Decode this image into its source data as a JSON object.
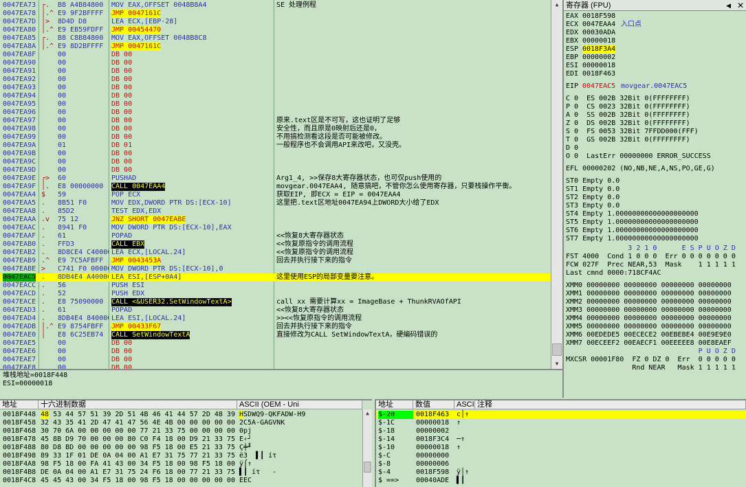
{
  "cpu": {
    "rows": [
      {
        "addr": "0047EA73",
        "mk": "┌.",
        "hex": "B8 A4B84800",
        "asm": "MOV EAX,OFFSET 0048B8A4",
        "cmt": "SE 处理例程"
      },
      {
        "addr": "0047EA78",
        "mk": "│.^",
        "hex": "E9 9F2BFFFF",
        "asm": "JMP 0047161C",
        "cmt": ""
      },
      {
        "addr": "0047EA7D",
        "mk": "│>",
        "hex": "8D4D D8",
        "asm": "LEA ECX,[EBP-28]",
        "cmt": ""
      },
      {
        "addr": "0047EA80",
        "mk": "│.^",
        "hex": "E9 EB59FDFF",
        "asm": "JMP 00454470",
        "cmt": ""
      },
      {
        "addr": "0047EA85",
        "mk": "┌.",
        "hex": "B8 C8B84800",
        "asm": "MOV EAX,OFFSET 0048B8C8",
        "cmt": ""
      },
      {
        "addr": "0047EA8A",
        "mk": "│.^",
        "hex": "E9 8D2BFFFF",
        "asm": "JMP 0047161C",
        "cmt": ""
      },
      {
        "addr": "0047EA8F",
        "mk": "",
        "hex": "00",
        "asm": "DB 00",
        "cmt": ""
      },
      {
        "addr": "0047EA90",
        "mk": "",
        "hex": "00",
        "asm": "DB 00",
        "cmt": ""
      },
      {
        "addr": "0047EA91",
        "mk": "",
        "hex": "00",
        "asm": "DB 00",
        "cmt": ""
      },
      {
        "addr": "0047EA92",
        "mk": "",
        "hex": "00",
        "asm": "DB 00",
        "cmt": ""
      },
      {
        "addr": "0047EA93",
        "mk": "",
        "hex": "00",
        "asm": "DB 00",
        "cmt": ""
      },
      {
        "addr": "0047EA94",
        "mk": "",
        "hex": "00",
        "asm": "DB 00",
        "cmt": ""
      },
      {
        "addr": "0047EA95",
        "mk": "",
        "hex": "00",
        "asm": "DB 00",
        "cmt": ""
      },
      {
        "addr": "0047EA96",
        "mk": "",
        "hex": "00",
        "asm": "DB 00",
        "cmt": ""
      },
      {
        "addr": "0047EA97",
        "mk": "",
        "hex": "00",
        "asm": "DB 00",
        "cmt": "原来.text区是不可写，这也证明了足够"
      },
      {
        "addr": "0047EA98",
        "mk": "",
        "hex": "00",
        "asm": "DB 00",
        "cmt": "安全性，而且原是0映射后还是0，"
      },
      {
        "addr": "0047EA99",
        "mk": "",
        "hex": "00",
        "asm": "DB 00",
        "cmt": "不用搞检测看这段是否可能被修改。"
      },
      {
        "addr": "0047EA9A",
        "mk": "",
        "hex": "01",
        "asm": "DB 01",
        "cmt": "一般程序也不会调用API来改吧，又没壳。"
      },
      {
        "addr": "0047EA9B",
        "mk": "",
        "hex": "00",
        "asm": "DB 00",
        "cmt": ""
      },
      {
        "addr": "0047EA9C",
        "mk": "",
        "hex": "00",
        "asm": "DB 00",
        "cmt": ""
      },
      {
        "addr": "0047EA9D",
        "mk": "",
        "hex": "00",
        "asm": "DB 00",
        "cmt": ""
      },
      {
        "addr": "0047EA9E",
        "mk": "┌>",
        "hex": "60",
        "asm": "PUSHAD",
        "cmt": "Arg1_4, >>保存8大寄存器状态，也可仅push使用的"
      },
      {
        "addr": "0047EA9F",
        "mk": "│.",
        "hex": "E8 00000000",
        "asm": "CALL 0047EAA4",
        "cmt": "movgear.0047EAA4, 随意搞吧，不管你怎么使用寄存器，只要栈操作平衡。"
      },
      {
        "addr": "0047EAA4",
        "mk": "$",
        "hex": "59",
        "asm": "POP ECX",
        "cmt": "获取EIP, 即ECX = EIP = 0047EAA4"
      },
      {
        "addr": "0047EAA5",
        "mk": ".",
        "hex": "8B51 F0",
        "asm": "MOV EDX,DWORD PTR DS:[ECX-10]",
        "cmt": "这里把.text区地址0047EA94上DWORD大小给了EDX"
      },
      {
        "addr": "0047EAA8",
        "mk": ".",
        "hex": "85D2",
        "asm": "TEST EDX,EDX",
        "cmt": ""
      },
      {
        "addr": "0047EAAA",
        "mk": ".v",
        "hex": "75 12",
        "asm": "JNZ SHORT 0047EABE",
        "cmt": ""
      },
      {
        "addr": "0047EAAC",
        "mk": ".",
        "hex": "8941 F0",
        "asm": "MOV DWORD PTR DS:[ECX-10],EAX",
        "cmt": ""
      },
      {
        "addr": "0047EAAF",
        "mk": ".",
        "hex": "61",
        "asm": "POPAD",
        "cmt": "<<恢复8大寄存器状态"
      },
      {
        "addr": "0047EAB0",
        "mk": ".",
        "hex": "FFD3",
        "asm": "CALL EBX",
        "cmt": "<<恢复原指令的调用流程"
      },
      {
        "addr": "0047EAB2",
        "mk": ".",
        "hex": "8D8CE4 C4000000",
        "asm": "LEA ECX,[LOCAL.24]",
        "cmt": "<<恢复原指令的调用流程"
      },
      {
        "addr": "0047EAB9",
        "mk": ".^",
        "hex": "E9 7C5AFBFF",
        "asm": "JMP 0043453A",
        "cmt": "回去并执行接下来的指令"
      },
      {
        "addr": "0047EABE",
        "mk": ">",
        "hex": "C741 F0 00000000",
        "asm": "MOV DWORD PTR DS:[ECX-10],0",
        "cmt": ""
      },
      {
        "addr": "0047EAC5",
        "mk": ".",
        "hex": "8DB4E4 A4000000",
        "asm": "LEA ESI,[ESP+0A4]",
        "cmt": "这里使用ESP的局部变量要注意。"
      },
      {
        "addr": "0047EACC",
        "mk": ".",
        "hex": "56",
        "asm": "PUSH ESI",
        "cmt": ""
      },
      {
        "addr": "0047EACD",
        "mk": ".",
        "hex": "52",
        "asm": "PUSH EDX",
        "cmt": ""
      },
      {
        "addr": "0047EACE",
        "mk": ".",
        "hex": "E8 75090000",
        "asm": "CALL <&USER32.SetWindowTextA>",
        "cmt": "call xx 需要计算xx = ImageBase + ThunkRVAOfAPI"
      },
      {
        "addr": "0047EAD3",
        "mk": ".",
        "hex": "61",
        "asm": "POPAD",
        "cmt": "<<恢复8大寄存器状态"
      },
      {
        "addr": "0047EAD4",
        "mk": ".",
        "hex": "8DB4E4 84000000",
        "asm": "LEA ESI,[LOCAL.24]",
        "cmt": ">><<恢复原指令的调用流程"
      },
      {
        "addr": "0047EADB",
        "mk": "│.^",
        "hex": "E9 8754FBFF",
        "asm": "JMP 00433F67",
        "cmt": "回去并执行接下来的指令"
      },
      {
        "addr": "0047EAE0",
        "mk": "│",
        "hex": "E8 6C25EB74",
        "asm": "CALL SetWindowTextA",
        "cmt": "直接修改为CALL SetWindowTextA，硬编码错误的"
      },
      {
        "addr": "0047EAE5",
        "mk": "",
        "hex": "00",
        "asm": "DB 00",
        "cmt": ""
      },
      {
        "addr": "0047EAE6",
        "mk": "",
        "hex": "00",
        "asm": "DB 00",
        "cmt": ""
      },
      {
        "addr": "0047EAE7",
        "mk": "",
        "hex": "00",
        "asm": "DB 00",
        "cmt": ""
      },
      {
        "addr": "0047EAE8",
        "mk": "",
        "hex": "00",
        "asm": "DB 00",
        "cmt": ""
      }
    ]
  },
  "info": {
    "line1": "堆栈地址=0018F448",
    "line2": "ESI=00000018"
  },
  "regs": {
    "title": "寄存器 (FPU)",
    "r32": [
      {
        "name": "EAX",
        "val": "0018F598",
        "note": ""
      },
      {
        "name": "ECX",
        "val": "0047EAA4",
        "note": "入口点"
      },
      {
        "name": "EDX",
        "val": "00030ADA",
        "note": ""
      },
      {
        "name": "EBX",
        "val": "00000018",
        "note": ""
      },
      {
        "name": "ESP",
        "val": "0018F3A4",
        "note": ""
      },
      {
        "name": "EBP",
        "val": "00000002",
        "note": ""
      },
      {
        "name": "ESI",
        "val": "00000018",
        "note": ""
      },
      {
        "name": "EDI",
        "val": "0018F463",
        "note": ""
      }
    ],
    "eip": {
      "name": "EIP",
      "val": "0047EAC5",
      "note": "movgear.0047EAC5"
    },
    "flags": [
      "C 0  ES 002B 32Bit 0(FFFFFFFF)",
      "P 0  CS 0023 32Bit 0(FFFFFFFF)",
      "A 0  SS 002B 32Bit 0(FFFFFFFF)",
      "Z 0  DS 002B 32Bit 0(FFFFFFFF)",
      "S 0  FS 0053 32Bit 7FFDD000(FFF)",
      "T 0  GS 002B 32Bit 0(FFFFFFFF)",
      "D 0",
      "O 0  LastErr 00000000 ERROR_SUCCESS"
    ],
    "efl": "EFL 00000202 (NO,NB,NE,A,NS,PO,GE,G)",
    "st": [
      "ST0 Empty 0.0",
      "ST1 Empty 0.0",
      "ST2 Empty 0.0",
      "ST3 Empty 0.0",
      "ST4 Empty 1.00000000000000000000",
      "ST5 Empty 1.00000000000000000000",
      "ST6 Empty 1.00000000000000000000",
      "ST7 Empty 1.00000000000000000000"
    ],
    "fpu": [
      "               3 2 1 0      E S P U O Z D",
      "FST 4000  Cond 1 0 0 0  Err 0 0 0 0 0 0 0",
      "FCW 027F  Prec NEAR,53  Mask    1 1 1 1 1",
      "Last cmnd 0000:718CF4AC"
    ],
    "xmm": [
      "XMM0 00000000 00000000 00000000 00000000",
      "XMM1 00000000 00000000 00000000 00000000",
      "XMM2 00000000 00000000 00000000 00000000",
      "XMM3 00000000 00000000 00000000 00000000",
      "XMM4 00000000 00000000 00000000 00000000",
      "XMM5 00000000 00000000 00000000 00000000",
      "XMM6 00EDEDE5 00ECECE2 00EBEBE4 00E9E9E0",
      "XMM7 00ECEEF2 00EAECF1 00EEEEE8 00E8EAEF"
    ],
    "mx_hdr": "                                P U O Z D",
    "mx": [
      "MXCSR 00001F80  FZ 0 DZ 0  Err  0 0 0 0 0",
      "                Rnd NEAR   Mask 1 1 1 1 1"
    ]
  },
  "dump": {
    "headers": [
      "地址",
      "十六进制数据",
      "ASCII (OEM - Uni"
    ],
    "rows": [
      {
        "addr": "0018F448",
        "hex": "48 53 44 57 51 39 2D 51 4B 46 41 44 57 2D 48 39",
        "ascii": "HSDWQ9-QKFADW-H9"
      },
      {
        "addr": "0018F458",
        "hex": "32 43 35 41 2D 47 41 47 56 4E 4B 00 00 00 00 00",
        "ascii": "2C5A-GAGVNK"
      },
      {
        "addr": "0018F468",
        "hex": "30 70 6A 00 00 00 00 00 77 21 33 75 00 00 00 00",
        "ascii": "0pj"
      },
      {
        "addr": "0018F478",
        "hex": "45 8B D9 70 00 00 00 80 C0 F4 18 00 D9 21 33 75",
        "ascii": "E‹┘"
      },
      {
        "addr": "0018F488",
        "hex": "80 D8 BD 00 00 00 00 00 98 F5 18 00 E5 21 33 75",
        "ascii": "Ç╪╜"
      },
      {
        "addr": "0018F498",
        "hex": "89 33 1F 01 DE 0A 04 00 A1 E7 31 75 77 21 33 75",
        "ascii": "ë3  ▌┃ íτ"
      },
      {
        "addr": "0018F4A8",
        "hex": "98 F5 18 00 FA 41 43 00 34 F5 18 00 98 F5 18 00",
        "ascii": "ÿ⌠↑ "
      },
      {
        "addr": "0018F4B8",
        "hex": "DE 0A 04 00 A1 E7 31 75 24 F6 18 00 77 21 33 75",
        "ascii": "▌┃ íτ   -"
      },
      {
        "addr": "0018F4C8",
        "hex": "45 45 43 00 34 F5 18 00 98 F5 18 00 00 00 00 00",
        "ascii": "EEC"
      }
    ]
  },
  "stack": {
    "headers": [
      "地址",
      "数值",
      "ASCII",
      "注释"
    ],
    "rows": [
      {
        "addr": "$-20",
        "val": "0018F463",
        "ascii": "c│↑",
        "cmt": ""
      },
      {
        "addr": "$-1C",
        "val": "00000018",
        "ascii": "↑",
        "cmt": ""
      },
      {
        "addr": "$-18",
        "val": "00000002",
        "ascii": "",
        "cmt": ""
      },
      {
        "addr": "$-14",
        "val": "0018F3C4",
        "ascii": "─↑",
        "cmt": ""
      },
      {
        "addr": "$-10",
        "val": "00000018",
        "ascii": "↑",
        "cmt": ""
      },
      {
        "addr": "$-C",
        "val": "00000000",
        "ascii": "",
        "cmt": ""
      },
      {
        "addr": "$-8",
        "val": "00000006",
        "ascii": "",
        "cmt": ""
      },
      {
        "addr": "$-4",
        "val": "0018F598",
        "ascii": "ÿ│↑",
        "cmt": ""
      },
      {
        "addr": "$ ==>",
        "val": "00040ADE",
        "ascii": "▌┃",
        "cmt": ""
      }
    ]
  }
}
